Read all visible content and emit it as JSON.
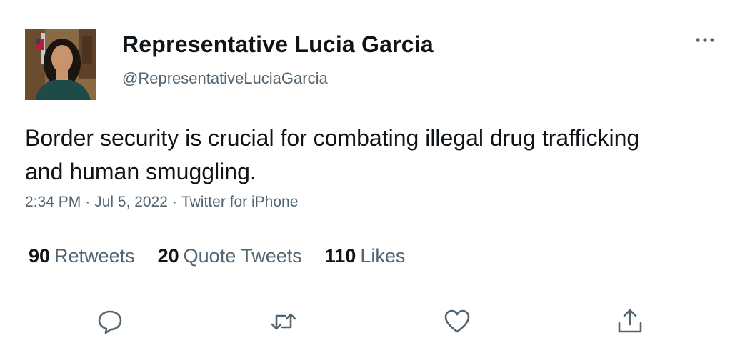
{
  "tweet": {
    "display_name": "Representative Lucia Garcia",
    "handle": "@RepresentativeLuciaGarcia",
    "avatar_icon": "profile-photo",
    "text": "Border security is crucial for combating illegal drug trafficking and human smuggling.",
    "time": "2:34 PM",
    "separator": "·",
    "date": "Jul 5, 2022",
    "source": "Twitter for iPhone",
    "more_icon": "more-dots-icon"
  },
  "stats": {
    "retweets": {
      "count": "90",
      "label": "Retweets"
    },
    "quote_tweets": {
      "count": "20",
      "label": "Quote Tweets"
    },
    "likes": {
      "count": "110",
      "label": "Likes"
    }
  },
  "actions": {
    "reply_icon": "reply-icon",
    "retweet_icon": "retweet-icon",
    "like_icon": "heart-icon",
    "share_icon": "share-icon"
  },
  "colors": {
    "text_primary": "#0f1419",
    "text_secondary": "#536471",
    "divider": "#cfd9de",
    "icon": "#536471"
  }
}
